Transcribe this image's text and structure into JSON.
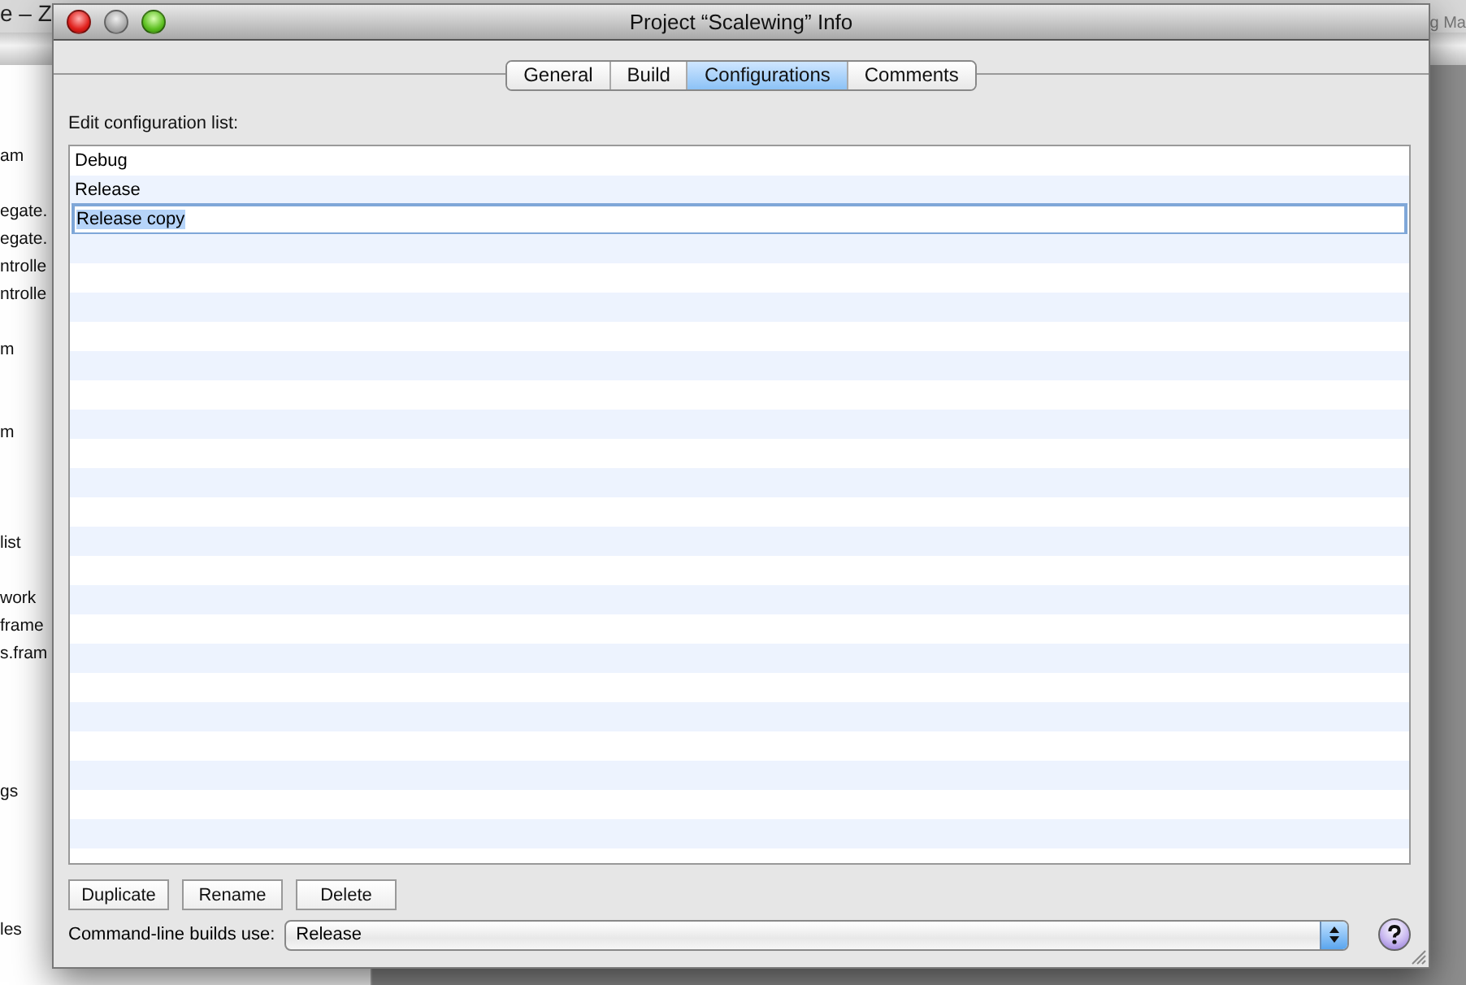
{
  "background_window": {
    "title_fragment": "e – Z",
    "corner_fragment": "g Ma",
    "sidebar_fragments": [
      "am",
      "egate.",
      "egate.",
      "ntrolle",
      "ntrolle",
      "m",
      "m",
      "list",
      "work",
      "frame",
      "s.fram",
      "gs",
      "les"
    ]
  },
  "window": {
    "title": "Project “Scalewing” Info"
  },
  "tabs": [
    {
      "label": "General",
      "selected": false
    },
    {
      "label": "Build",
      "selected": false
    },
    {
      "label": "Configurations",
      "selected": true
    },
    {
      "label": "Comments",
      "selected": false
    }
  ],
  "list_label": "Edit configuration list:",
  "configurations": [
    {
      "name": "Debug",
      "editing": false
    },
    {
      "name": "Release",
      "editing": false
    },
    {
      "name": "Release copy",
      "editing": true
    }
  ],
  "buttons": [
    "Duplicate",
    "Rename",
    "Delete"
  ],
  "command_line": {
    "label": "Command-line builds use:",
    "value": "Release"
  }
}
